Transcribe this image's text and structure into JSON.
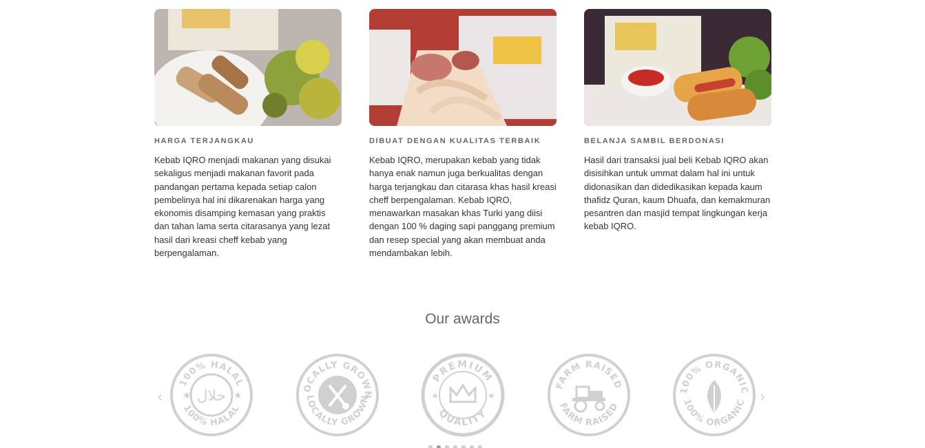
{
  "features": [
    {
      "title": "HARGA TERJANGKAU",
      "text": "Kebab IQRO menjadi makanan yang disukai sekaligus menjadi makanan favorit pada pandangan pertama kepada setiap calon pembelinya hal ini dikarenakan harga yang ekonomis disamping kemasan yang praktis dan tahan lama serta citarasanya yang lezat hasil dari kreasi cheff kebab yang berpengalaman."
    },
    {
      "title": "DIBUAT DENGAN KUALITAS TERBAIK",
      "text": "Kebab IQRO, merupakan kebab yang tidak hanya enak namun juga berkualitas dengan harga terjangkau dan citarasa khas hasil kreasi cheff berpengalaman. Kebab IQRO, menawarkan masakan khas Turki yang diisi dengan 100 % daging sapi panggang premium dan resep special yang akan membuat anda mendambakan lebih."
    },
    {
      "title": "BELANJA SAMBIL BERDONASI",
      "text": "Hasil dari transaksi jual beli Kebab IQRO akan disisihkan untuk ummat dalam hal ini untuk didonasikan dan didedikasikan kepada kaum thafidz Quran, kaum Dhuafa, dan kemakmuran pesantren dan masjid tempat lingkungan kerja kebab IQRO."
    }
  ],
  "awards": {
    "title": "Our awards",
    "badges": [
      {
        "top": "100% HALAL",
        "bottom": "100% HALAL",
        "center": "حلال",
        "icon": "halal-badge-icon"
      },
      {
        "top": "LOCALLY GROWN",
        "bottom": "LOCALLY GROWN",
        "center": "",
        "icon": "locally-grown-badge-icon"
      },
      {
        "top": "PREMIUM",
        "bottom": "QUALITY",
        "center": "",
        "icon": "premium-quality-badge-icon"
      },
      {
        "top": "FARM RAISED",
        "bottom": "FARM RAISED",
        "center": "",
        "icon": "farm-raised-badge-icon"
      },
      {
        "top": "100% ORGANIC",
        "bottom": "100% ORGANIC",
        "center": "",
        "icon": "organic-badge-icon"
      }
    ],
    "prev_arrow": "‹",
    "next_arrow": "›",
    "active_dot": 1
  },
  "colors": {
    "badge_gray": "#d0d0d0",
    "title_gray": "#666666",
    "text_dark": "#333333"
  }
}
